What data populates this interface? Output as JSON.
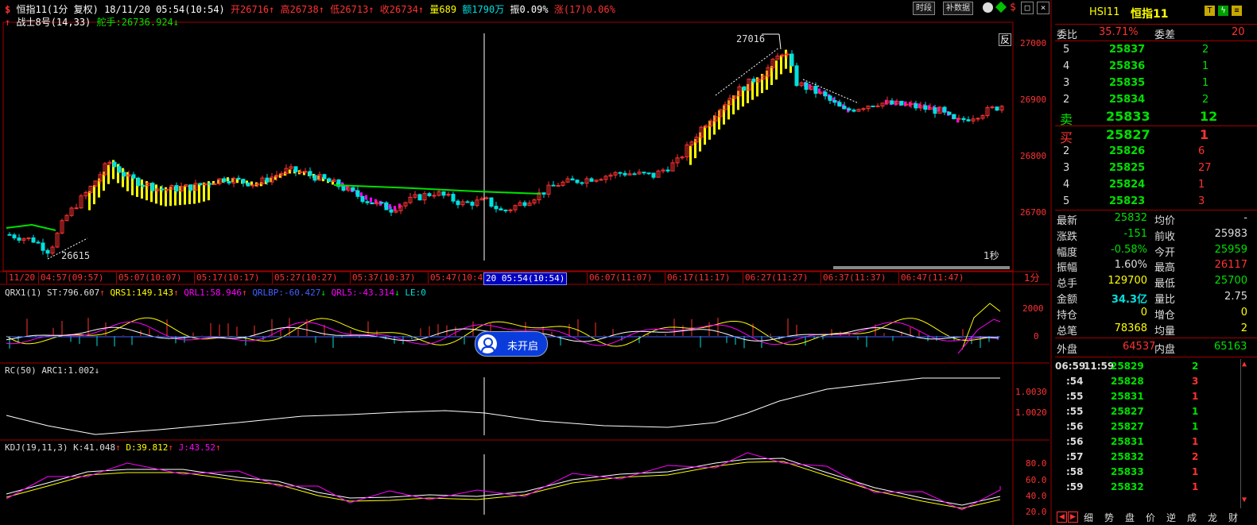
{
  "header": {
    "icon": "$",
    "symbol": "恒指11(1分 复权)",
    "datetime": "18/11/20 05:54(10:54)",
    "open": "开26716",
    "high": "高26738",
    "low": "低26713",
    "close": "收26734",
    "volume": "量689",
    "amount": "额1790万",
    "amplitude": "振0.09%",
    "change": "涨(17)0.06%",
    "indicator": "战士8号(14,33)",
    "rudder": "舵手:26736.924",
    "btn_timeshare": "时段",
    "btn_fill": "补数据",
    "fan_label": "反",
    "speed_label": "1秒",
    "high_mark": "27016",
    "low_mark": "26615"
  },
  "colors": {
    "up": "#ff3232",
    "down": "#00e0e0",
    "green": "#00e000",
    "yellow": "#ffff00",
    "magenta": "#ff00ff",
    "grid": "#a00000",
    "white": "#ffffff"
  },
  "price_axis": [
    "27000",
    "26900",
    "26800",
    "26700"
  ],
  "time_axis": [
    "11/20",
    "04:57(09:57)",
    "05:07(10:07)",
    "05:17(10:17)",
    "05:27(10:27)",
    "05:37(10:37)",
    "05:47(10:47)",
    "06:07(11:07)",
    "06:17(11:17)",
    "06:27(11:27)",
    "06:37(11:37)",
    "06:47(11:47)"
  ],
  "time_cursor": "20 05:54(10:54)",
  "period": "1分",
  "qrx": {
    "title": "QRX1(1)",
    "st": "ST:796.607",
    "qrs1": "QRS1:149.143",
    "qrl1": "QRL1:58.946",
    "qrlbp": "QRLBP:-60.427",
    "qrl5": "QRL5:-43.314",
    "le": "LE:0",
    "axis": [
      "2000",
      "0"
    ],
    "badge": "未开启"
  },
  "rc": {
    "title": "RC(50)",
    "arc": "ARC1:1.002",
    "axis": [
      "1.0030",
      "1.0020"
    ]
  },
  "kdj": {
    "title": "KDJ(19,11,3)",
    "k": "K:41.048",
    "d": "D:39.812",
    "j": "J:43.52",
    "axis": [
      "80.0",
      "60.0",
      "40.0",
      "20.0"
    ]
  },
  "quote": {
    "code": "HSI11",
    "name": "恒指11",
    "webi_label": "委比",
    "webi": "35.71%",
    "weicha_label": "委差",
    "weicha": "20",
    "asks": [
      {
        "lvl": "5",
        "price": "25837",
        "vol": "2"
      },
      {
        "lvl": "4",
        "price": "25836",
        "vol": "1"
      },
      {
        "lvl": "3",
        "price": "25835",
        "vol": "1"
      },
      {
        "lvl": "2",
        "price": "25834",
        "vol": "2"
      },
      {
        "lvl": "卖",
        "price": "25833",
        "vol": "12"
      }
    ],
    "bids": [
      {
        "lvl": "买",
        "price": "25827",
        "vol": "1"
      },
      {
        "lvl": "2",
        "price": "25826",
        "vol": "6"
      },
      {
        "lvl": "3",
        "price": "25825",
        "vol": "27"
      },
      {
        "lvl": "4",
        "price": "25824",
        "vol": "1"
      },
      {
        "lvl": "5",
        "price": "25823",
        "vol": "3"
      }
    ],
    "stats": [
      {
        "l1": "最新",
        "v1": "25832",
        "l2": "均价",
        "v2": "-"
      },
      {
        "l1": "涨跌",
        "v1": "-151",
        "l2": "前收",
        "v2": "25983"
      },
      {
        "l1": "幅度",
        "v1": "-0.58%",
        "l2": "今开",
        "v2": "25959"
      },
      {
        "l1": "振幅",
        "v1": "1.60%",
        "l2": "最高",
        "v2": "26117"
      },
      {
        "l1": "总手",
        "v1": "129700",
        "l2": "最低",
        "v2": "25700"
      },
      {
        "l1": "金额",
        "v1": "34.3亿",
        "l2": "量比",
        "v2": "2.75"
      },
      {
        "l1": "持仓",
        "v1": "0",
        "l2": "增仓",
        "v2": "0"
      },
      {
        "l1": "总笔",
        "v1": "78368",
        "l2": "均量",
        "v2": "2"
      }
    ],
    "outer_label": "外盘",
    "outer": "64537",
    "inner_label": "内盘",
    "inner": "65163",
    "ticks": [
      {
        "t": "06:59",
        "t2": "11:59",
        "p": "25829",
        "v": "2"
      },
      {
        "t": ":54",
        "t2": "",
        "p": "25828",
        "v": "3"
      },
      {
        "t": ":55",
        "t2": "",
        "p": "25831",
        "v": "1"
      },
      {
        "t": ":55",
        "t2": "",
        "p": "25827",
        "v": "1"
      },
      {
        "t": ":56",
        "t2": "",
        "p": "25827",
        "v": "1"
      },
      {
        "t": ":56",
        "t2": "",
        "p": "25831",
        "v": "1"
      },
      {
        "t": ":57",
        "t2": "",
        "p": "25832",
        "v": "2"
      },
      {
        "t": ":58",
        "t2": "",
        "p": "25833",
        "v": "1"
      },
      {
        "t": ":59",
        "t2": "",
        "p": "25832",
        "v": "1"
      }
    ],
    "tabs": [
      "细",
      "势",
      "盘",
      "价",
      "逆",
      "成",
      "龙",
      "财"
    ]
  }
}
